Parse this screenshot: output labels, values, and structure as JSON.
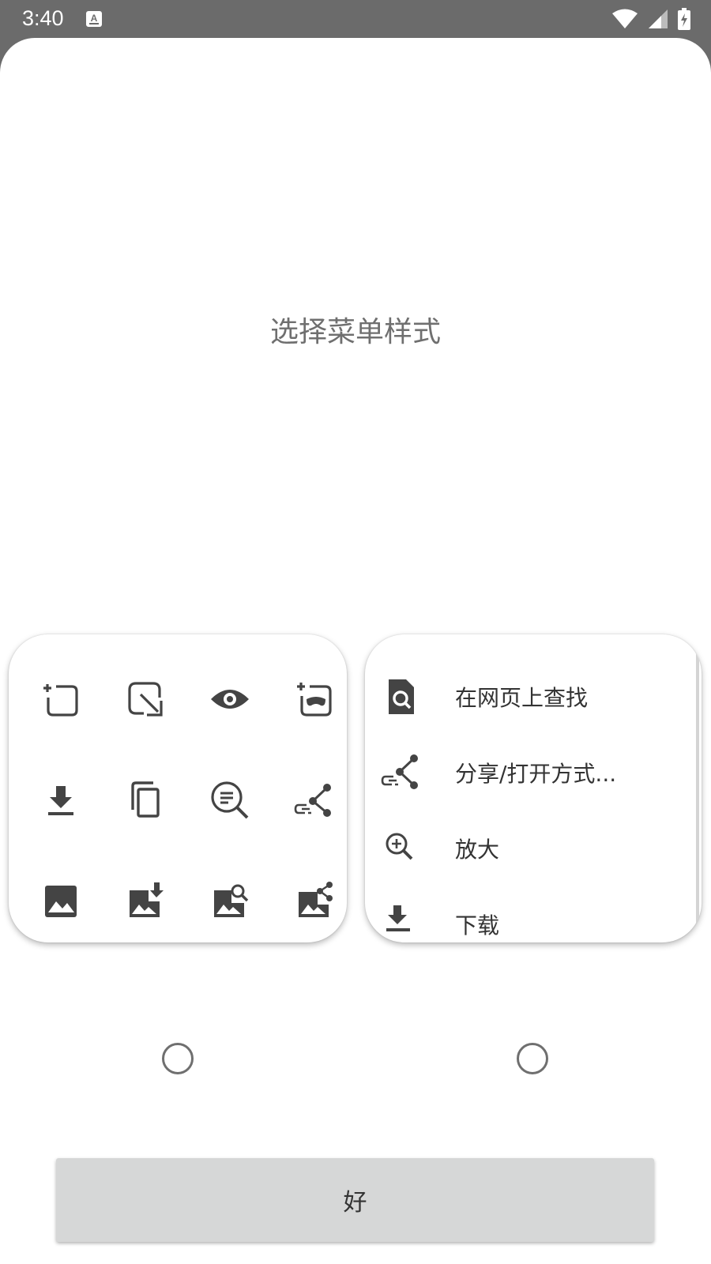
{
  "status_bar": {
    "time": "3:40",
    "notification_icon": "keyboard-a-icon",
    "icons": [
      "wifi-icon",
      "signal-icon",
      "battery-charging-icon"
    ]
  },
  "dialog": {
    "title": "选择菜单样式",
    "grid_style": {
      "icons": [
        "add-tab-icon",
        "open-in-new-window-icon",
        "eye-icon",
        "incognito-tab-icon",
        "download-icon",
        "copy-icon",
        "search-text-icon",
        "share-link-icon",
        "image-icon",
        "download-image-icon",
        "search-image-icon",
        "share-image-icon"
      ],
      "selected": false
    },
    "list_style": {
      "items": [
        {
          "icon": "find-in-page-icon",
          "label": "在网页上查找"
        },
        {
          "icon": "share-link-icon",
          "label": "分享/打开方式..."
        },
        {
          "icon": "zoom-in-icon",
          "label": "放大"
        },
        {
          "icon": "download-icon",
          "label": "下载"
        }
      ],
      "selected": false
    },
    "ok_label": "好"
  },
  "colors": {
    "status_bar": "#6b6b6b",
    "icon": "#444444",
    "title": "#6f6f6f",
    "button": "#d6d7d7"
  }
}
